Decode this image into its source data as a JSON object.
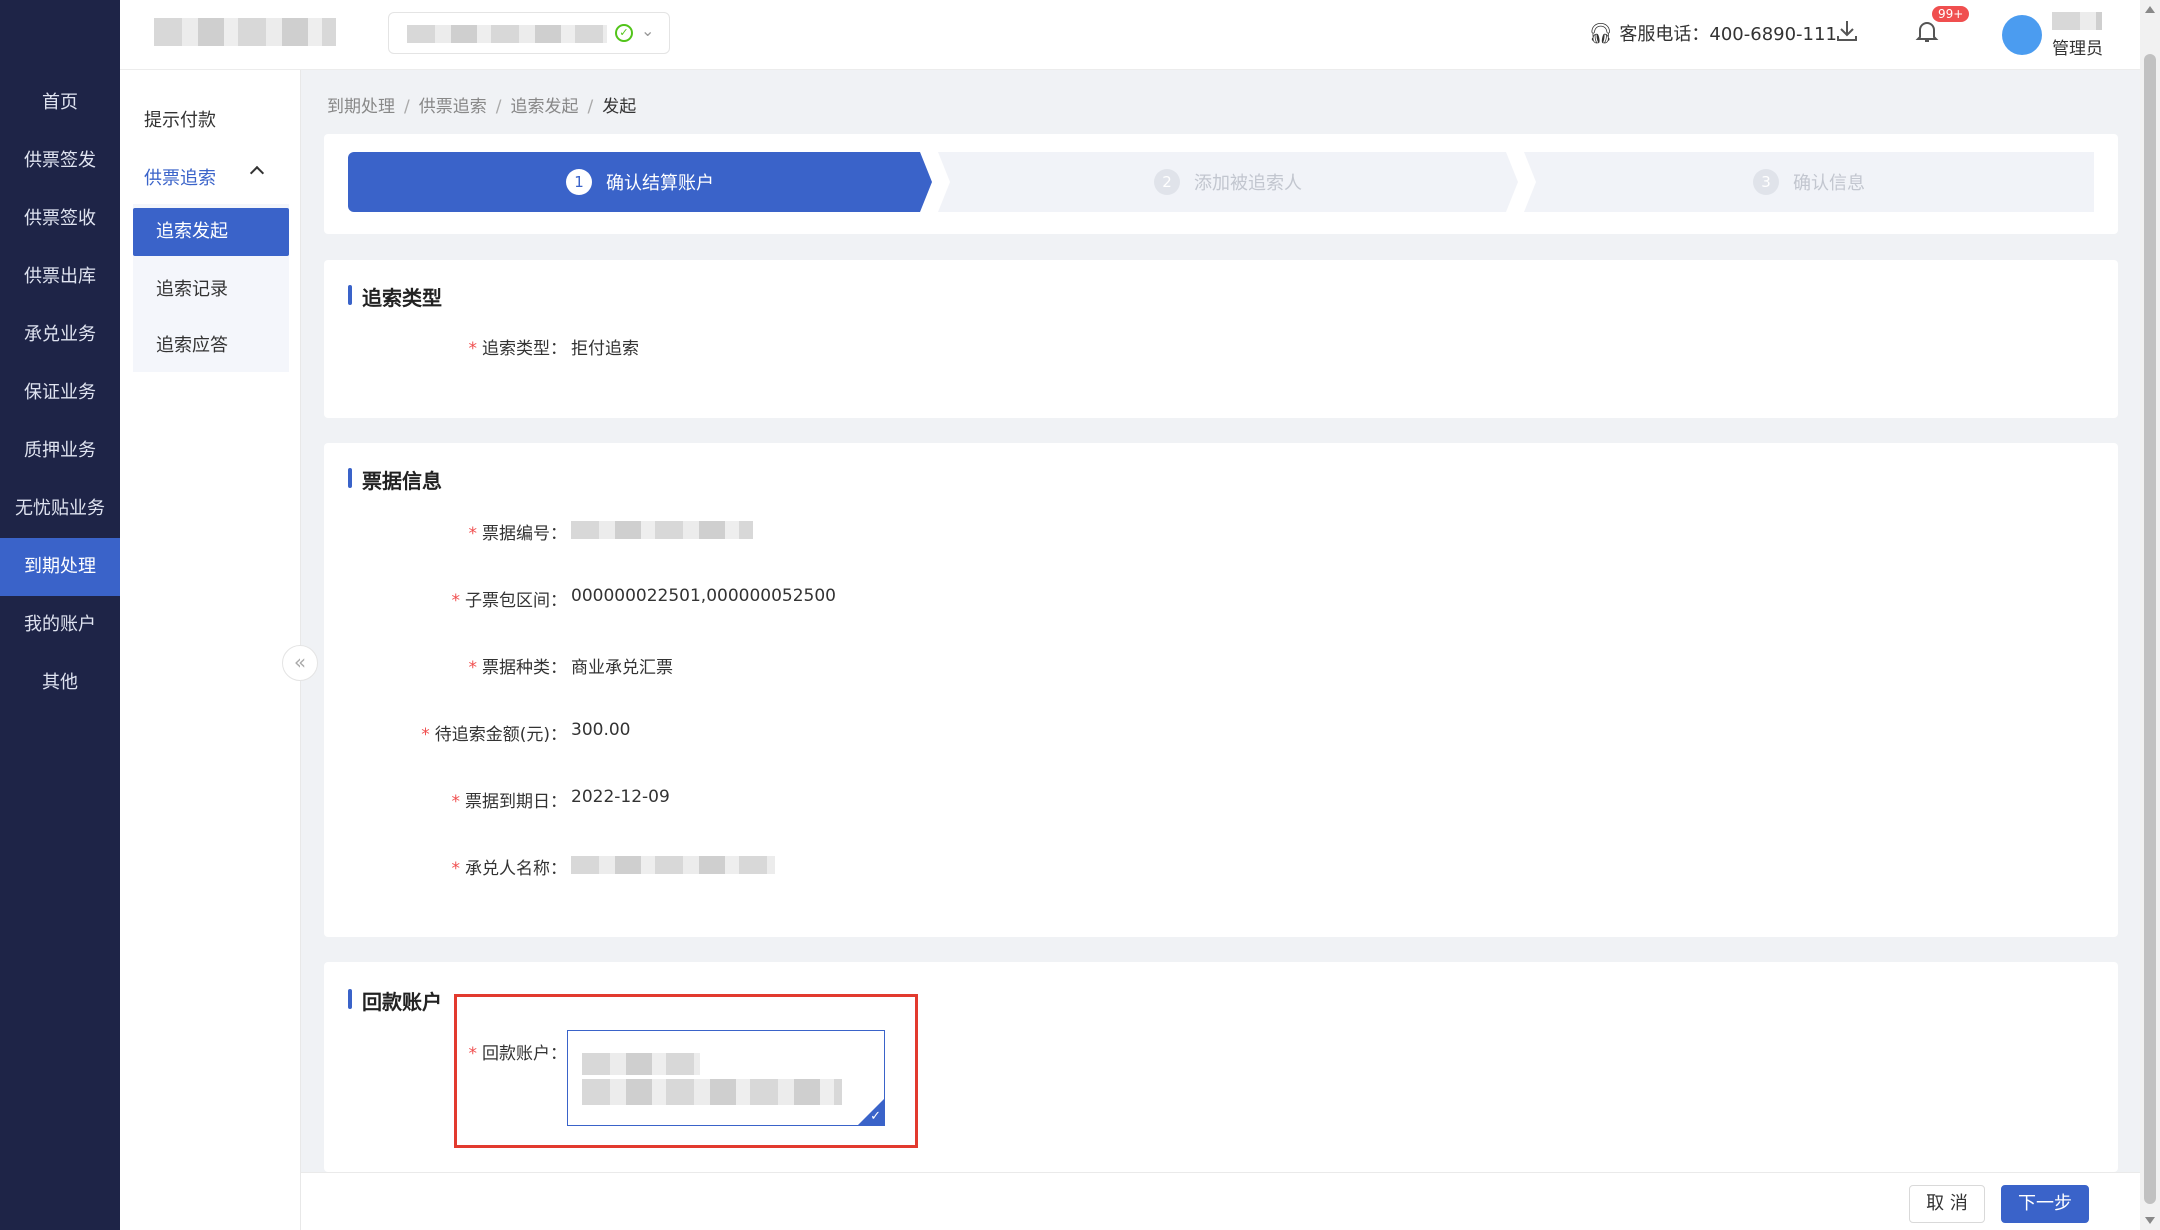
{
  "nav": {
    "items": [
      {
        "label": "首页"
      },
      {
        "label": "供票签发"
      },
      {
        "label": "供票签收"
      },
      {
        "label": "供票出库"
      },
      {
        "label": "承兑业务"
      },
      {
        "label": "保证业务"
      },
      {
        "label": "质押业务"
      },
      {
        "label": "无忧贴业务"
      },
      {
        "label": "到期处理",
        "active": true
      },
      {
        "label": "我的账户"
      },
      {
        "label": "其他"
      }
    ]
  },
  "header": {
    "service_label": "客服电话：400-6890-111",
    "notification_badge": "99+",
    "user_role": "管理员"
  },
  "subnav": {
    "pay_prompt": "提示付款",
    "recourse": "供票追索",
    "children": [
      "追索发起",
      "追索记录",
      "追索应答"
    ]
  },
  "breadcrumb": [
    "到期处理",
    "供票追索",
    "追索发起",
    "发起"
  ],
  "steps": [
    {
      "num": "1",
      "label": "确认结算账户",
      "state": "active"
    },
    {
      "num": "2",
      "label": "添加被追索人",
      "state": "pending"
    },
    {
      "num": "3",
      "label": "确认信息",
      "state": "pending"
    }
  ],
  "type_section": {
    "title": "追索类型",
    "fields": [
      {
        "label": "追索类型：",
        "value": "拒付追索"
      }
    ]
  },
  "bill_section": {
    "title": "票据信息",
    "fields": [
      {
        "label": "票据编号：",
        "value": ""
      },
      {
        "label": "子票包区间：",
        "value": "000000022501,000000052500"
      },
      {
        "label": "票据种类：",
        "value": "商业承兑汇票"
      },
      {
        "label": "待追索金额(元)：",
        "value": "300.00"
      },
      {
        "label": "票据到期日：",
        "value": "2022-12-09"
      },
      {
        "label": "承兑人名称：",
        "value": ""
      }
    ]
  },
  "refund_section": {
    "title": "回款账户",
    "label": "回款账户："
  },
  "footer": {
    "cancel_label": "取 消",
    "next_label": "下一步"
  },
  "colors": {
    "primary": "#3a63c9",
    "nav_bg": "#1e2447",
    "highlight_box": "#e23a2e",
    "required_mark": "#f04f4f"
  }
}
